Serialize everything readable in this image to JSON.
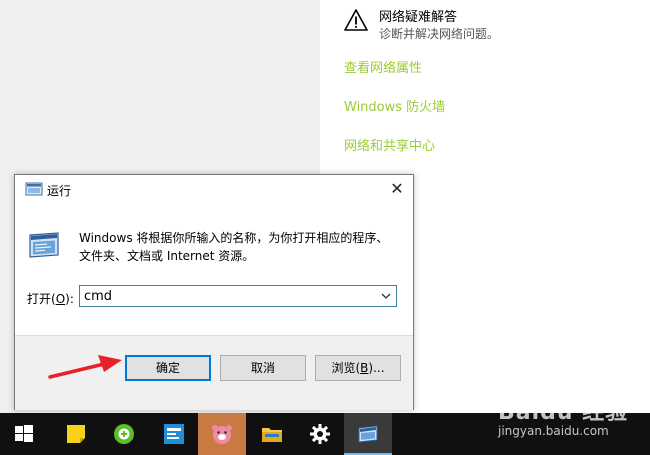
{
  "right_panel": {
    "troubleshoot_title": "网络疑难解答",
    "troubleshoot_desc": "诊断并解决网络问题。",
    "links": [
      "查看网络属性",
      "Windows 防火墙",
      "网络和共享中心"
    ],
    "link_color": "#9acd32"
  },
  "run_dialog": {
    "title": "运行",
    "close_glyph": "✕",
    "description": "Windows 将根据你所输入的名称，为你打开相应的程序、文件夹、文档或 Internet 资源。",
    "open_label": "打开(",
    "open_label_key": "O",
    "open_label_end": "):",
    "command_value": "cmd",
    "buttons": {
      "ok": "确定",
      "cancel": "取消",
      "browse_pre": "浏览(",
      "browse_key": "B",
      "browse_post": ")..."
    }
  },
  "annotation": {
    "arrow_color": "#e8202a"
  },
  "taskbar": {
    "items": [
      "start-icon",
      "sticky-notes-icon",
      "green-app-icon",
      "news-app-icon",
      "pig-app-icon",
      "file-explorer-icon",
      "settings-gear-icon",
      "run-icon"
    ],
    "active_color": "#76b9ed"
  },
  "watermark": {
    "brand": "Baidu 经验",
    "url": "jingyan.baidu.com"
  }
}
